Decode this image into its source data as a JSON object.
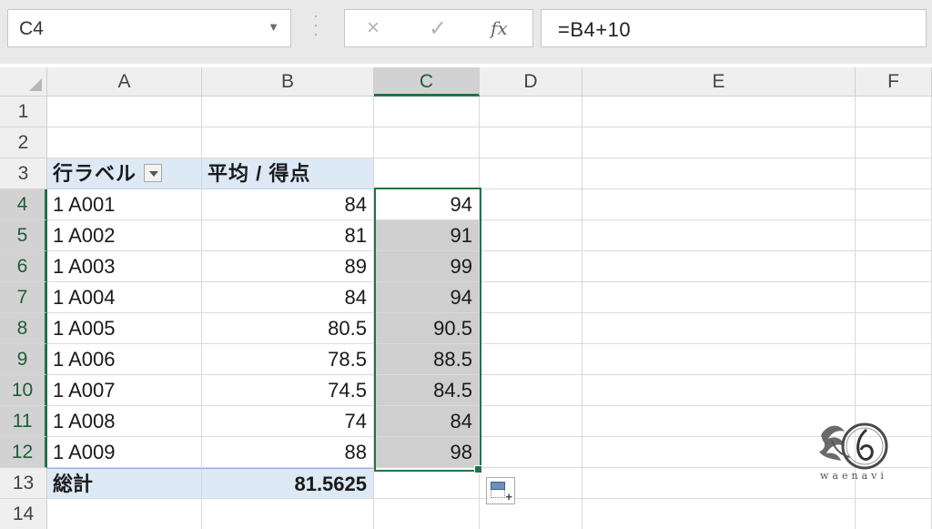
{
  "formula_bar": {
    "name_box": "C4",
    "cancel_icon": "×",
    "enter_icon": "✓",
    "fx_label": "fx",
    "formula": "=B4+10"
  },
  "columns": [
    "A",
    "B",
    "C",
    "D",
    "E",
    "F"
  ],
  "selected_column": "C",
  "rows": [
    "1",
    "2",
    "3",
    "4",
    "5",
    "6",
    "7",
    "8",
    "9",
    "10",
    "11",
    "12",
    "13",
    "14"
  ],
  "selected_rows": [
    "4",
    "5",
    "6",
    "7",
    "8",
    "9",
    "10",
    "11",
    "12"
  ],
  "pivot": {
    "header_row_label": "行ラベル",
    "header_value_label": "平均 / 得点",
    "rows": [
      {
        "label": "1 A001",
        "value": "84"
      },
      {
        "label": "1 A002",
        "value": "81"
      },
      {
        "label": "1 A003",
        "value": "89"
      },
      {
        "label": "1 A004",
        "value": "84"
      },
      {
        "label": "1 A005",
        "value": "80.5"
      },
      {
        "label": "1 A006",
        "value": "78.5"
      },
      {
        "label": "1 A007",
        "value": "74.5"
      },
      {
        "label": "1 A008",
        "value": "74"
      },
      {
        "label": "1 A009",
        "value": "88"
      }
    ],
    "total_label": "総計",
    "total_value": "81.5625"
  },
  "column_c": [
    "94",
    "91",
    "99",
    "94",
    "90.5",
    "88.5",
    "84.5",
    "84",
    "98"
  ],
  "icons": {
    "filter": "filter-dropdown-icon",
    "quick_analysis": "quick-analysis-icon",
    "logo": "waenavi-logo"
  },
  "watermark_text": "waenavi",
  "colors": {
    "accent": "#217346",
    "pivot_header_bg": "#dde9f5",
    "selection_bg": "#cfcfcf"
  }
}
